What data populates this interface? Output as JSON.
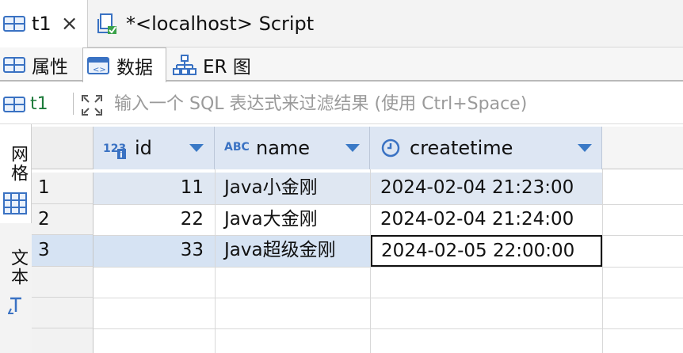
{
  "editor_tabs": [
    {
      "label": "t1",
      "icon": "table-grid-icon",
      "closable": true
    },
    {
      "label": "*<localhost> Script",
      "icon": "script-file-icon"
    }
  ],
  "sub_tabs": [
    {
      "label": "属性",
      "icon": "table-grid-icon"
    },
    {
      "label": "数据",
      "icon": "table-data-icon",
      "selected": true
    },
    {
      "label": "ER 图",
      "icon": "er-diagram-icon"
    }
  ],
  "filter": {
    "table_name": "t1",
    "placeholder": "输入一个 SQL 表达式来过滤结果 (使用 Ctrl+Space)"
  },
  "side_panel": {
    "grid_label": "网格",
    "text_label": "文本"
  },
  "grid": {
    "columns": [
      {
        "name": "id",
        "type_icon": "123"
      },
      {
        "name": "name",
        "type_icon": "ABC"
      },
      {
        "name": "createtime",
        "type_icon": "clock-icon"
      }
    ],
    "rows": [
      {
        "num": "1",
        "id": "11",
        "name": "Java小金刚",
        "createtime": "2024-02-04 21:23:00"
      },
      {
        "num": "2",
        "id": "22",
        "name": "Java大金刚",
        "createtime": "2024-02-04 21:24:00"
      },
      {
        "num": "3",
        "id": "33",
        "name": "Java超级金刚",
        "createtime": "2024-02-05 22:00:00"
      }
    ],
    "selected_row": 3
  },
  "colors": {
    "accent": "#3a79c6",
    "header_bg": "#dde6f3",
    "selected_row_bg": "#d9e5f4"
  }
}
